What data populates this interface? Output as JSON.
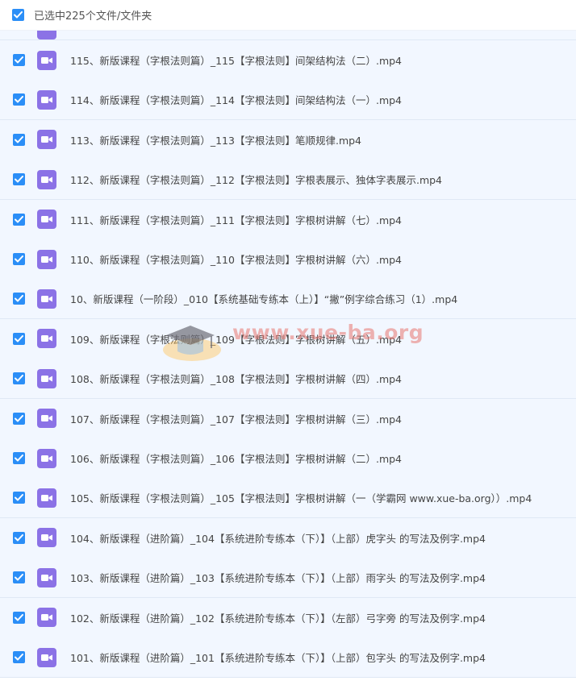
{
  "header": {
    "label": "已选中225个文件/文件夹"
  },
  "watermark": {
    "text": "www.xue-ba.org"
  },
  "colors": {
    "checkbox": "#2b8ef7",
    "video_icon": "#8b72e6",
    "row_bg": "#f2f7ff"
  },
  "files": [
    {
      "name": "115、新版课程（字根法则篇）_115【字根法则】间架结构法（二）.mp4",
      "checked": true,
      "icon": "video-file-icon"
    },
    {
      "name": "114、新版课程（字根法则篇）_114【字根法则】间架结构法（一）.mp4",
      "checked": true,
      "icon": "video-file-icon"
    },
    {
      "name": "113、新版课程（字根法则篇）_113【字根法则】笔顺规律.mp4",
      "checked": true,
      "icon": "video-file-icon"
    },
    {
      "name": "112、新版课程（字根法则篇）_112【字根法则】字根表展示、独体字表展示.mp4",
      "checked": true,
      "icon": "video-file-icon"
    },
    {
      "name": "111、新版课程（字根法则篇）_111【字根法则】字根树讲解（七）.mp4",
      "checked": true,
      "icon": "video-file-icon"
    },
    {
      "name": "110、新版课程（字根法则篇）_110【字根法则】字根树讲解（六）.mp4",
      "checked": true,
      "icon": "video-file-icon"
    },
    {
      "name": "10、新版课程（一阶段）_010【系统基础专练本（上）】“撇”例字综合练习（1）.mp4",
      "checked": true,
      "icon": "video-file-icon"
    },
    {
      "name": "109、新版课程（字根法则篇）_109【字根法则】字根树讲解（五）.mp4",
      "checked": true,
      "icon": "video-file-icon"
    },
    {
      "name": "108、新版课程（字根法则篇）_108【字根法则】字根树讲解（四）.mp4",
      "checked": true,
      "icon": "video-file-icon"
    },
    {
      "name": "107、新版课程（字根法则篇）_107【字根法则】字根树讲解（三）.mp4",
      "checked": true,
      "icon": "video-file-icon"
    },
    {
      "name": "106、新版课程（字根法则篇）_106【字根法则】字根树讲解（二）.mp4",
      "checked": true,
      "icon": "video-file-icon"
    },
    {
      "name": "105、新版课程（字根法则篇）_105【字根法则】字根树讲解（一（学霸网 www.xue-ba.org））.mp4",
      "checked": true,
      "icon": "video-file-icon"
    },
    {
      "name": "104、新版课程（进阶篇）_104【系统进阶专练本（下）】（上部）虎字头 的写法及例字.mp4",
      "checked": true,
      "icon": "video-file-icon"
    },
    {
      "name": "103、新版课程（进阶篇）_103【系统进阶专练本（下）】（上部）雨字头 的写法及例字.mp4",
      "checked": true,
      "icon": "video-file-icon"
    },
    {
      "name": "102、新版课程（进阶篇）_102【系统进阶专练本（下）】（左部）弓字旁 的写法及例字.mp4",
      "checked": true,
      "icon": "video-file-icon"
    },
    {
      "name": "101、新版课程（进阶篇）_101【系统进阶专练本（下）】（上部）包字头 的写法及例字.mp4",
      "checked": true,
      "icon": "video-file-icon"
    }
  ]
}
